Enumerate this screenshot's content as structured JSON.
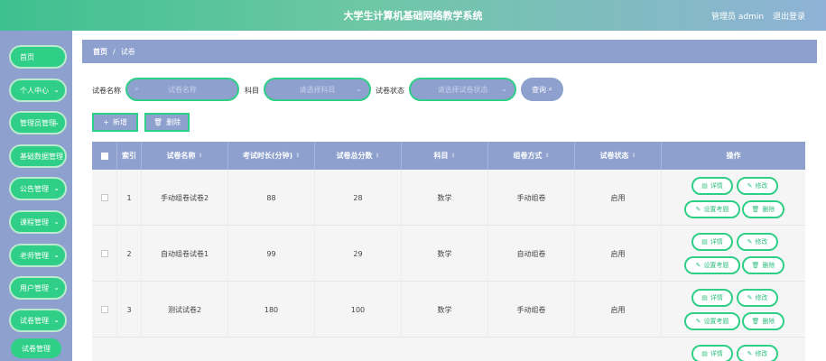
{
  "header": {
    "title": "大学生计算机基础网络教学系统",
    "admin": "管理员 admin",
    "logout": "退出登录"
  },
  "sidebar": {
    "items": [
      {
        "label": "首页"
      },
      {
        "label": "个人中心"
      },
      {
        "label": "管理员管理"
      },
      {
        "label": "基础数据管理"
      },
      {
        "label": "公告管理"
      },
      {
        "label": "课程管理"
      },
      {
        "label": "老师管理"
      },
      {
        "label": "用户管理"
      },
      {
        "label": "试卷管理"
      }
    ],
    "sub_item": "试卷管理"
  },
  "breadcrumb": {
    "home": "首页",
    "sep": "/",
    "current": "试卷"
  },
  "search": {
    "name_label": "试卷名称",
    "name_placeholder": "试卷名称",
    "subject_label": "科目",
    "subject_placeholder": "请选择科目",
    "status_label": "试卷状态",
    "status_placeholder": "请选择试卷状态",
    "query_label": "查询"
  },
  "actions": {
    "add_label": "新增",
    "delete_label": "删除"
  },
  "table": {
    "columns": [
      "索引",
      "试卷名称",
      "考试时长(分钟)",
      "试卷总分数",
      "科目",
      "组卷方式",
      "试卷状态",
      "操作"
    ],
    "rows": [
      {
        "index": "1",
        "name": "手动组卷试卷2",
        "duration": "88",
        "score": "28",
        "subject": "数学",
        "method": "手动组卷",
        "status": "启用"
      },
      {
        "index": "2",
        "name": "自动组卷试卷1",
        "duration": "99",
        "score": "29",
        "subject": "数学",
        "method": "自动组卷",
        "status": "启用"
      },
      {
        "index": "3",
        "name": "测试试卷2",
        "duration": "180",
        "score": "100",
        "subject": "数学",
        "method": "手动组卷",
        "status": "启用"
      }
    ],
    "ops": {
      "detail": "详情",
      "edit": "修改",
      "set_questions": "设置考题",
      "delete": "删除"
    }
  }
}
